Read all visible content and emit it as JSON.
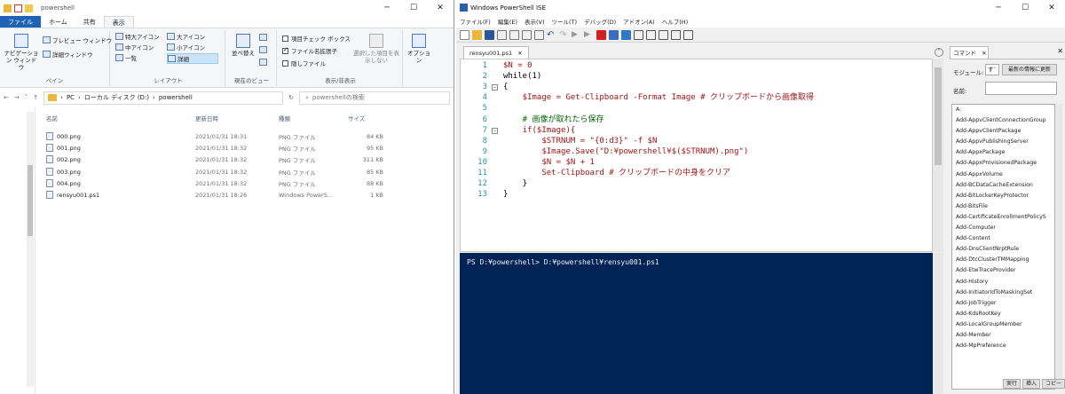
{
  "explorer": {
    "title": "powershell",
    "tabs": [
      "ファイル",
      "ホーム",
      "共有",
      "表示"
    ],
    "ribbon": {
      "nav_pane": "ナビゲーション ウィンドウ",
      "preview": "プレビュー ウィンドウ",
      "details_pane": "詳細ウィンドウ",
      "pane_group": "ペイン",
      "xl_icons": "特大アイコン",
      "l_icons": "大アイコン",
      "m_icons": "中アイコン",
      "s_icons": "小アイコン",
      "list": "一覧",
      "details": "詳細",
      "layout_group": "レイアウト",
      "sort": "並べ替え",
      "current_view_group": "現在のビュー",
      "item_checkbox": "項目チェック ボックス",
      "file_ext": "ファイル名拡張子",
      "hidden_files": "隠しファイル",
      "hide_selected": "選択した項目を表示しない",
      "show_hide_group": "表示/非表示",
      "options": "オプション"
    },
    "address": [
      "PC",
      "ローカル ディスク (D:)",
      "powershell"
    ],
    "search_placeholder": "powershellの検索",
    "columns": [
      "名前",
      "更新日時",
      "種類",
      "サイズ"
    ],
    "files": [
      {
        "name": "000.png",
        "date": "2021/01/31 18:31",
        "type": "PNG ファイル",
        "size": "84 KB"
      },
      {
        "name": "001.png",
        "date": "2021/01/31 18:32",
        "type": "PNG ファイル",
        "size": "95 KB"
      },
      {
        "name": "002.png",
        "date": "2021/01/31 18:32",
        "type": "PNG ファイル",
        "size": "311 KB"
      },
      {
        "name": "003.png",
        "date": "2021/01/31 18:32",
        "type": "PNG ファイル",
        "size": "85 KB"
      },
      {
        "name": "004.png",
        "date": "2021/01/31 18:32",
        "type": "PNG ファイル",
        "size": "88 KB"
      },
      {
        "name": "rensyu001.ps1",
        "date": "2021/01/31 18:26",
        "type": "Windows PowerS...",
        "size": "1 KB"
      }
    ]
  },
  "ise": {
    "title": "Windows PowerShell ISE",
    "menu": [
      "ファイル(F)",
      "編集(E)",
      "表示(V)",
      "ツール(T)",
      "デバッグ(D)",
      "アドオン(A)",
      "ヘルプ(H)"
    ],
    "tab": "rensyu001.ps1",
    "code_lines": [
      "$N = 0",
      "while(1)",
      "{",
      "    $Image = Get-Clipboard -Format Image # クリップボードから画像取得",
      "",
      "    # 画像が取れたら保存",
      "    if($Image){",
      "        $STRNUM = \"{0:d3}\" -f $N",
      "        $Image.Save(\"D:¥powershell¥$($STRNUM).png\")",
      "        $N = $N + 1",
      "        Set-Clipboard # クリップボードの中身をクリア",
      "    }",
      "}"
    ],
    "console_text": "PS D:¥powershell> D:¥powershell¥rensyu001.ps1",
    "commands_panel": {
      "tab": "コマンド",
      "module_label": "モジュール:",
      "module_value": "す",
      "refresh": "最新の情報に更新",
      "name_label": "名前:",
      "items": [
        "A:",
        "Add-AppvClientConnectionGroup",
        "Add-AppvClientPackage",
        "Add-AppvPublishingServer",
        "Add-AppxPackage",
        "Add-AppxProvisionedPackage",
        "Add-AppxVolume",
        "Add-BCDataCacheExtension",
        "Add-BitLockerKeyProtector",
        "Add-BitsFile",
        "Add-CertificateEnrollmentPolicyS",
        "Add-Computer",
        "Add-Content",
        "Add-DnsClientNrptRule",
        "Add-DtcClusterTMMapping",
        "Add-EtwTraceProvider",
        "Add-History",
        "Add-InitiatorIdToMaskingSet",
        "Add-JobTrigger",
        "Add-KdsRootKey",
        "Add-LocalGroupMember",
        "Add-Member",
        "Add-MpPreference"
      ],
      "buttons": [
        "実行",
        "挿入",
        "コピー"
      ]
    }
  }
}
